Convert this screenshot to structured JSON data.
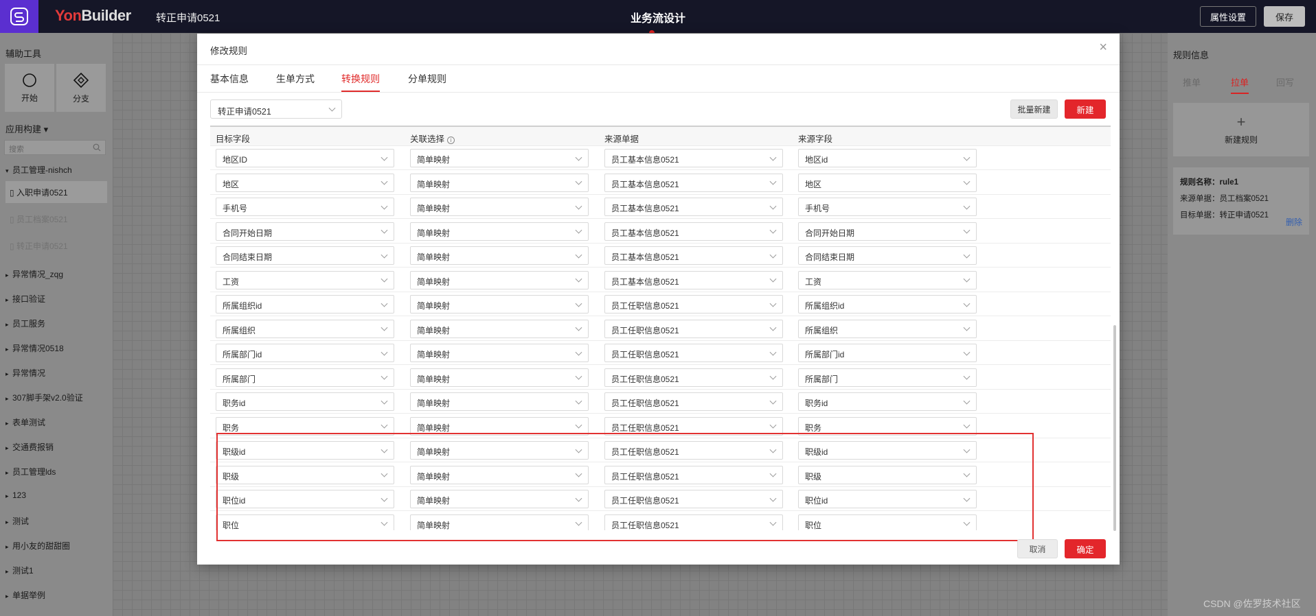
{
  "topbar": {
    "brand_left": "Yon",
    "brand_right": "Builder",
    "app_name": "转正申请0521",
    "center_title": "业务流设计",
    "props_button": "属性设置",
    "save_button": "保存"
  },
  "left_panel": {
    "title": "辅助工具",
    "tools": [
      {
        "label": "开始"
      },
      {
        "label": "分支"
      }
    ],
    "section": "应用构建 ▾",
    "search_placeholder": "搜索",
    "group_open": "员工管理-nishch",
    "leaves": [
      {
        "label": "入职申请0521"
      },
      {
        "label": "员工档案0521"
      },
      {
        "label": "转正申请0521"
      }
    ],
    "groups": [
      {
        "label": "异常情况_zqg"
      },
      {
        "label": "接口验证"
      },
      {
        "label": "员工服务"
      },
      {
        "label": "异常情况0518"
      },
      {
        "label": "异常情况"
      },
      {
        "label": "307脚手架v2.0验证"
      },
      {
        "label": "表单测试"
      },
      {
        "label": "交通费报销"
      },
      {
        "label": "员工管理lds"
      },
      {
        "label": "123"
      },
      {
        "label": "测试"
      },
      {
        "label": "用小友的甜甜圈"
      },
      {
        "label": "测试1"
      },
      {
        "label": "单据举例"
      }
    ]
  },
  "right_panel": {
    "title": "规则信息",
    "tabs": [
      {
        "label": "推单"
      },
      {
        "label": "拉单"
      },
      {
        "label": "回写"
      }
    ],
    "new_rule": "新建规则",
    "rule_name": "规则名称：rule1",
    "rule_source": "来源单据：员工档案0521",
    "rule_target": "目标单据：转正申请0521",
    "delete": "删除"
  },
  "modal": {
    "title": "修改规则",
    "close": "×",
    "tabs": [
      {
        "label": "基本信息"
      },
      {
        "label": "生单方式"
      },
      {
        "label": "转换规则"
      },
      {
        "label": "分单规则"
      }
    ],
    "doc_select": "转正申请0521",
    "batch_button": "批量新建",
    "new_button": "新建",
    "columns": [
      "目标字段",
      "关联选择",
      "来源单据",
      "来源字段"
    ],
    "info_icon": "i",
    "rows": [
      {
        "target": "地区ID",
        "mode": "简单映射",
        "source_doc": "员工基本信息0521",
        "source_field": "地区id"
      },
      {
        "target": "地区",
        "mode": "简单映射",
        "source_doc": "员工基本信息0521",
        "source_field": "地区"
      },
      {
        "target": "手机号",
        "mode": "简单映射",
        "source_doc": "员工基本信息0521",
        "source_field": "手机号"
      },
      {
        "target": "合同开始日期",
        "mode": "简单映射",
        "source_doc": "员工基本信息0521",
        "source_field": "合同开始日期"
      },
      {
        "target": "合同结束日期",
        "mode": "简单映射",
        "source_doc": "员工基本信息0521",
        "source_field": "合同结束日期"
      },
      {
        "target": "工资",
        "mode": "简单映射",
        "source_doc": "员工基本信息0521",
        "source_field": "工资"
      },
      {
        "target": "所属组织id",
        "mode": "简单映射",
        "source_doc": "员工任职信息0521",
        "source_field": "所属组织id"
      },
      {
        "target": "所属组织",
        "mode": "简单映射",
        "source_doc": "员工任职信息0521",
        "source_field": "所属组织"
      },
      {
        "target": "所属部门id",
        "mode": "简单映射",
        "source_doc": "员工任职信息0521",
        "source_field": "所属部门id"
      },
      {
        "target": "所属部门",
        "mode": "简单映射",
        "source_doc": "员工任职信息0521",
        "source_field": "所属部门"
      },
      {
        "target": "职务id",
        "mode": "简单映射",
        "source_doc": "员工任职信息0521",
        "source_field": "职务id"
      },
      {
        "target": "职务",
        "mode": "简单映射",
        "source_doc": "员工任职信息0521",
        "source_field": "职务"
      },
      {
        "target": "职级id",
        "mode": "简单映射",
        "source_doc": "员工任职信息0521",
        "source_field": "职级id"
      },
      {
        "target": "职级",
        "mode": "简单映射",
        "source_doc": "员工任职信息0521",
        "source_field": "职级"
      },
      {
        "target": "职位id",
        "mode": "简单映射",
        "source_doc": "员工任职信息0521",
        "source_field": "职位id"
      },
      {
        "target": "职位",
        "mode": "简单映射",
        "source_doc": "员工任职信息0521",
        "source_field": "职位"
      }
    ],
    "cancel_button": "取消",
    "ok_button": "确定"
  },
  "watermark": "CSDN @佐罗技术社区",
  "colors": {
    "accent": "#e3262b",
    "topbar": "#151627",
    "logo": "#5b2fd0",
    "link": "#335fb0"
  }
}
